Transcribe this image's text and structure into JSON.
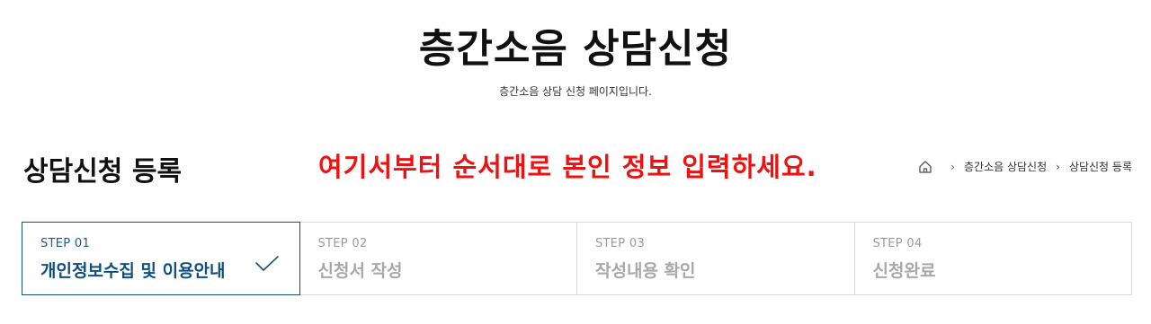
{
  "header": {
    "title": "층간소음 상담신청",
    "subtitle": "층간소음 상담 신청 페이지입니다."
  },
  "section": {
    "title": "상담신청 등록",
    "annotation": "여기서부터 순서대로 본인 정보 입력하세요.",
    "annotation_color": "#ee1111"
  },
  "breadcrumb": {
    "home_icon": "home-icon",
    "items": [
      "층간소음 상담신청",
      "상담신청 등록"
    ]
  },
  "steps": [
    {
      "number": "STEP 01",
      "label": "개인정보수집 및 이용안내",
      "active": true,
      "icon": "check-icon"
    },
    {
      "number": "STEP 02",
      "label": "신청서 작성",
      "active": false
    },
    {
      "number": "STEP 03",
      "label": "작성내용 확인",
      "active": false
    },
    {
      "number": "STEP 04",
      "label": "신청완료",
      "active": false
    }
  ],
  "colors": {
    "active_step_border": "#1a4f7a",
    "active_step_text": "#0f4e80",
    "inactive_step_text": "#a8a8a8"
  }
}
